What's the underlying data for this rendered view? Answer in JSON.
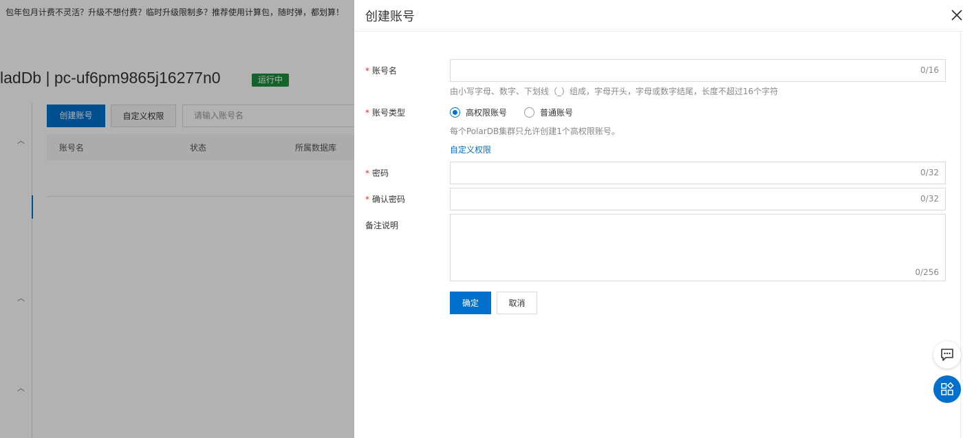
{
  "background": {
    "banner": "包年包月计费不灵活？升级不想付费？临时升级限制多？推荐使用计算包，随时弹，都划算！",
    "page_title": "ladDb | pc-uf6pm9865j16277n0",
    "status": "运行中",
    "buttons": {
      "create": "创建账号",
      "custom_perm": "自定义权限"
    },
    "search_placeholder": "请输入账号名",
    "table_headers": [
      "账号名",
      "状态",
      "所属数据库"
    ]
  },
  "drawer": {
    "title": "创建账号",
    "account_name": {
      "label": "账号名",
      "value": "",
      "counter": "0/16",
      "help": "由小写字母、数字、下划线（_）组成，字母开头，字母或数字结尾，长度不超过16个字符"
    },
    "account_type": {
      "label": "账号类型",
      "options": [
        {
          "label": "高权限账号",
          "checked": true
        },
        {
          "label": "普通账号",
          "checked": false
        }
      ],
      "help": "每个PolarDB集群只允许创建1个高权限账号。",
      "link": "自定义权限"
    },
    "password": {
      "label": "密码",
      "value": "",
      "counter": "0/32"
    },
    "confirm_password": {
      "label": "确认密码",
      "value": "",
      "counter": "0/32"
    },
    "remark": {
      "label": "备注说明",
      "value": "",
      "counter": "0/256"
    },
    "confirm_button": "确定",
    "cancel_button": "取消",
    "required_mark": "*"
  },
  "colors": {
    "primary": "#0070cc",
    "required": "#d93026",
    "success": "#1e8e3e"
  }
}
